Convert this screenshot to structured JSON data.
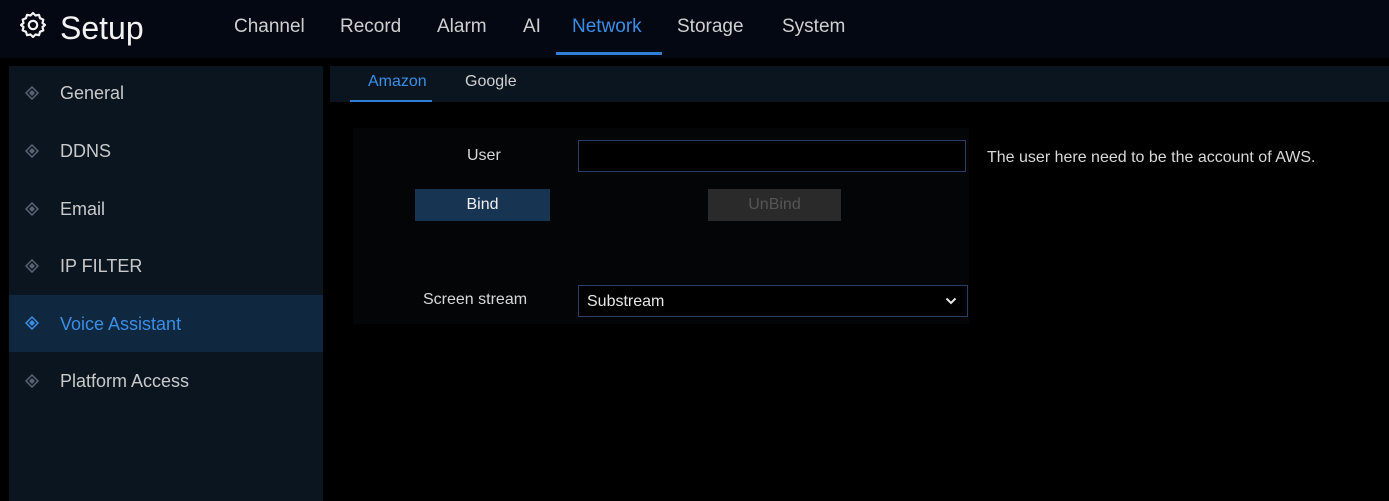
{
  "app": {
    "title": "Setup",
    "logo_icon": "gear-icon"
  },
  "topnav": {
    "tabs": [
      {
        "label": "Channel"
      },
      {
        "label": "Record"
      },
      {
        "label": "Alarm"
      },
      {
        "label": "AI"
      },
      {
        "label": "Network"
      },
      {
        "label": "Storage"
      },
      {
        "label": "System"
      }
    ],
    "active": "Network"
  },
  "sidebar": {
    "items": [
      {
        "label": "General",
        "icon": "diamond-icon"
      },
      {
        "label": "DDNS",
        "icon": "diamond-icon"
      },
      {
        "label": "Email",
        "icon": "diamond-icon"
      },
      {
        "label": "IP FILTER",
        "icon": "diamond-icon"
      },
      {
        "label": "Voice Assistant",
        "icon": "diamond-icon"
      },
      {
        "label": "Platform Access",
        "icon": "diamond-icon"
      }
    ],
    "active": "Voice Assistant"
  },
  "subtabs": {
    "items": [
      {
        "label": "Amazon"
      },
      {
        "label": "Google"
      }
    ],
    "active": "Amazon"
  },
  "form": {
    "user_label": "User",
    "user_value": "",
    "user_hint": "The user here need to be the account of AWS.",
    "bind_label": "Bind",
    "unbind_label": "UnBind",
    "stream_label": "Screen stream",
    "stream_value": "Substream"
  },
  "colors": {
    "accent": "#3a8ee6",
    "sidebar_bg": "#0b1520",
    "sidebar_active_bg": "#0f2840",
    "button_bg": "#173452",
    "disabled_bg": "#2a2a2a"
  }
}
